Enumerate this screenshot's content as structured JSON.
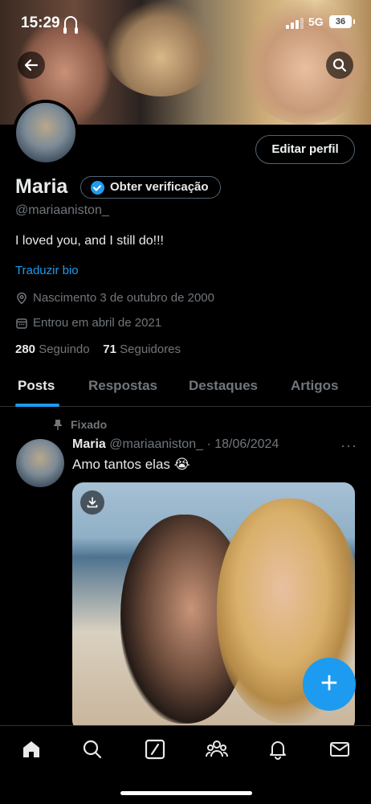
{
  "status_bar": {
    "time": "15:29",
    "network": "5G",
    "battery": "36"
  },
  "profile": {
    "name": "Maria",
    "verify_label": "Obter verificação",
    "handle": "@mariaaniston_",
    "bio": "I loved you, and I still do!!!",
    "translate_label": "Traduzir bio",
    "birth": "Nascimento 3 de outubro de 2000",
    "joined": "Entrou em abril de 2021",
    "following_count": "280",
    "following_label": "Seguindo",
    "followers_count": "71",
    "followers_label": "Seguidores",
    "edit_label": "Editar perfil"
  },
  "tabs": [
    {
      "label": "Posts"
    },
    {
      "label": "Respostas"
    },
    {
      "label": "Destaques"
    },
    {
      "label": "Artigos"
    }
  ],
  "post": {
    "pinned_label": "Fixado",
    "author": "Maria",
    "handle_date": "@mariaaniston_ · 18/06/2024",
    "text": "Amo tantos elas 😭",
    "more": "···"
  },
  "fab_label": "+",
  "icons": {
    "back": "arrow-left-icon",
    "search": "search-icon",
    "home": "home-icon",
    "explore": "search-icon",
    "grok": "slash-box-icon",
    "communities": "people-icon",
    "notifications": "bell-icon",
    "messages": "mail-icon"
  },
  "colors": {
    "accent": "#1d9bf0",
    "background": "#000000",
    "muted": "#71767b"
  }
}
